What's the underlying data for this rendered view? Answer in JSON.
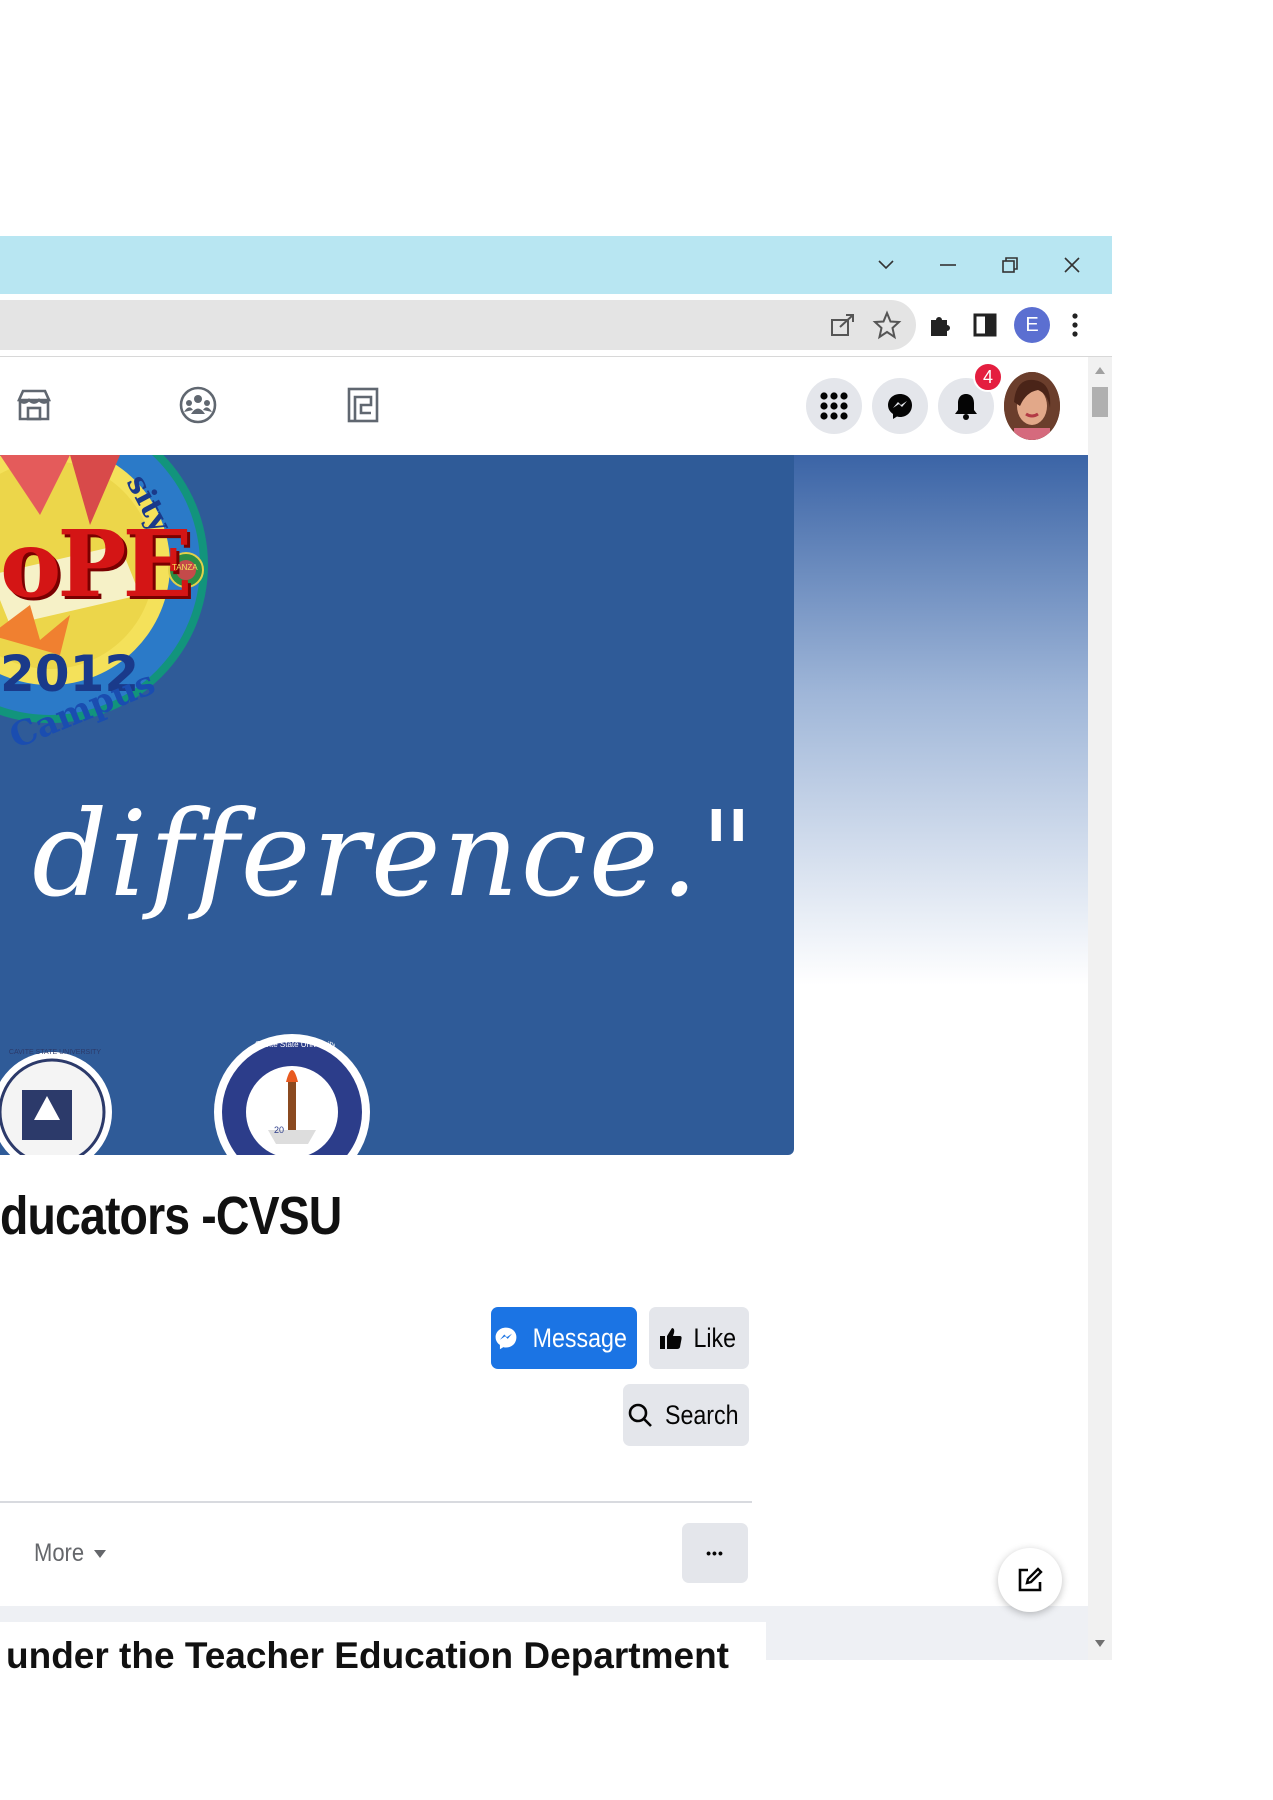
{
  "browser": {
    "window_controls": [
      "tab-search",
      "minimize",
      "restore",
      "close"
    ],
    "profile_initial": "E",
    "colors": {
      "titlebar": "#b8e6f2",
      "omnibox": "#e4e4e4",
      "profile": "#5b6fd1"
    }
  },
  "facebook": {
    "nav_icons": [
      "marketplace-icon",
      "groups-icon",
      "gaming-icon"
    ],
    "notification_count": "4",
    "page": {
      "cover": {
        "logo_text_top": "sity",
        "logo_text_main": "oPE",
        "logo_year": "2012",
        "logo_ribbon": "Campus",
        "logo_badge": "TANZA",
        "tagline": "difference.\"",
        "seal_left": "CAVITE STATE UNIVERSITY",
        "seal_right": "Cavite State University - Tanza Campus",
        "seal_year": "20"
      },
      "title": "ducators -CVSU",
      "buttons": {
        "message": "Message",
        "like": "Like",
        "search": "Search",
        "more": "More",
        "ellipsis": "•••"
      }
    },
    "colors": {
      "primary": "#1b74e4",
      "cover": "#2f5b98",
      "badge": "#e41e3f"
    }
  },
  "caption": "under the Teacher Education Department"
}
